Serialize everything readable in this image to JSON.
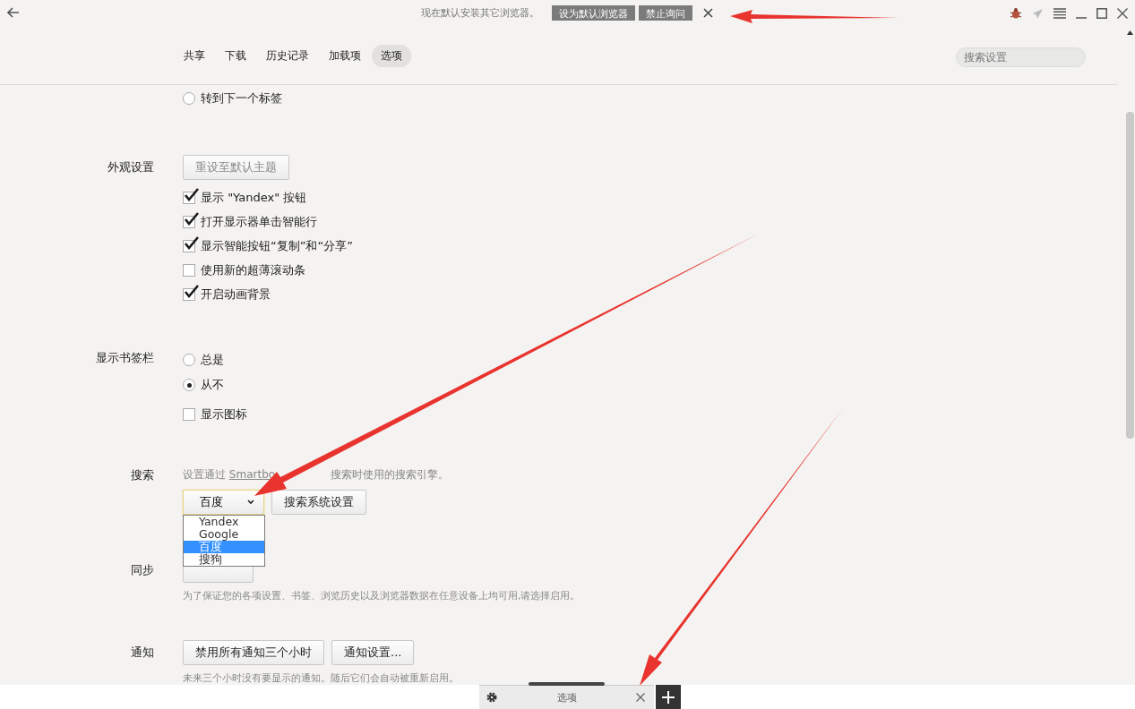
{
  "top_bar": {
    "notice": {
      "text": "现在默认安装其它浏览器。",
      "buttons": [
        "设为默认浏览器",
        "禁止询问"
      ]
    }
  },
  "nav_tabs": [
    {
      "label": "共享",
      "selected": false
    },
    {
      "label": "下载",
      "selected": false
    },
    {
      "label": "历史记录",
      "selected": false
    },
    {
      "label": "加载项",
      "selected": false
    },
    {
      "label": "选项",
      "selected": true
    }
  ],
  "search": {
    "placeholder": "搜索设置"
  },
  "sections": [
    {
      "items": [
        {
          "kind": "radio",
          "label": "转到下一个标签",
          "selected": false
        }
      ]
    },
    {
      "label": "外观设置",
      "items": [
        {
          "kind": "buttons",
          "buttons": [
            {
              "label": "重设至默认主题",
              "disabled": true
            }
          ]
        },
        {
          "kind": "checkbox",
          "label": "显示 \"Yandex\" 按钮",
          "checked": true
        },
        {
          "kind": "checkbox",
          "label": "打开显示器单击智能行",
          "checked": true
        },
        {
          "kind": "checkbox",
          "label": "显示智能按钮“复制”和“分享”",
          "checked": true
        },
        {
          "kind": "checkbox",
          "label": "使用新的超薄滚动条",
          "checked": false
        },
        {
          "kind": "checkbox",
          "label": "开启动画背景",
          "checked": true
        }
      ]
    },
    {
      "label": "显示书签栏",
      "items": [
        {
          "kind": "radio",
          "label": "总是",
          "selected": false
        },
        {
          "kind": "radio",
          "label": "从不",
          "selected": true
        },
        {
          "kind": "checkbox",
          "label": "显示图标",
          "checked": false
        }
      ]
    },
    {
      "label": "搜索",
      "items": [
        {
          "kind": "linktext",
          "before": "设置通过 ",
          "link": "Smartbo",
          "after": "搜索时使用的搜索引擎。"
        },
        {
          "kind": "dropdown",
          "value": "百度",
          "expanded": true,
          "options": [
            {
              "label": "Yandex",
              "selected": false
            },
            {
              "label": "Google",
              "selected": false
            },
            {
              "label": "百度",
              "selected": true
            },
            {
              "label": "搜狗",
              "selected": false
            }
          ],
          "button": "搜索系统设置"
        }
      ]
    },
    {
      "label": "同步",
      "items": [
        {
          "kind": "covered_button"
        },
        {
          "kind": "note",
          "text": "为了保证您的各项设置、书签、浏览历史以及浏览器数据在任意设备上均可用,请选择启用。"
        }
      ]
    },
    {
      "label": "通知",
      "items": [
        {
          "kind": "buttons",
          "buttons": [
            {
              "label": "禁用所有通知三个小时",
              "disabled": false
            },
            {
              "label": "通知设置...",
              "disabled": false
            }
          ]
        },
        {
          "kind": "note",
          "text": "未来三个小时没有要显示的通知。随后它们会自动被重新启用。"
        }
      ]
    }
  ],
  "tab_bar": {
    "tabs": [
      {
        "label": "选项",
        "selected": true
      }
    ]
  }
}
